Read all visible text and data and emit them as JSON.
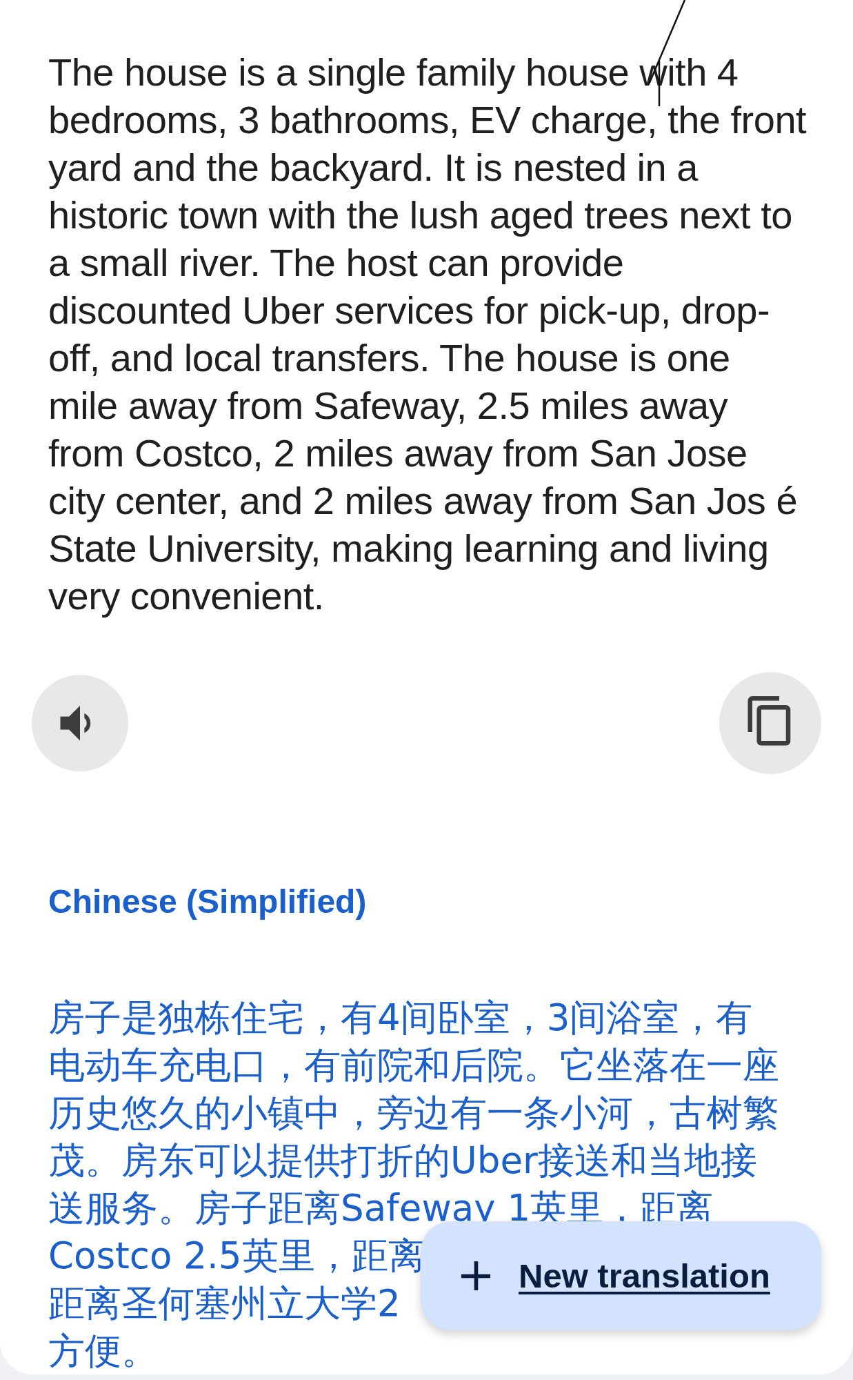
{
  "source_text": "The house is a single family house with 4 bedrooms, 3 bathrooms, EV charge, the front yard and the backyard. It is nested in a historic town with the lush aged trees next to a small river. The host can provide discounted Uber services for pick-up, drop-off, and local transfers. The house is one mile away from Safeway, 2.5 miles away from Costco, 2 miles away from San Jose city center, and 2 miles away from San Jos é State University, making learning and living very convenient.",
  "target_language": "Chinese (Simplified)",
  "translation_lines": [
    "房子是独栋住宅，有4间卧室，3间浴室，有",
    "电动车充电口，有前院和后院。它坐落在一座",
    "历史悠久的小镇中，旁边有一条小河，古树繁",
    "茂。房东可以提供打折的Uber接送和当地接",
    "送服务。房子距离Safeway 1英里，距离",
    "Costco 2.5英里，距离",
    "距离圣何塞州立大学2",
    "方便。"
  ],
  "new_translation_button": {
    "label": "New translation"
  }
}
